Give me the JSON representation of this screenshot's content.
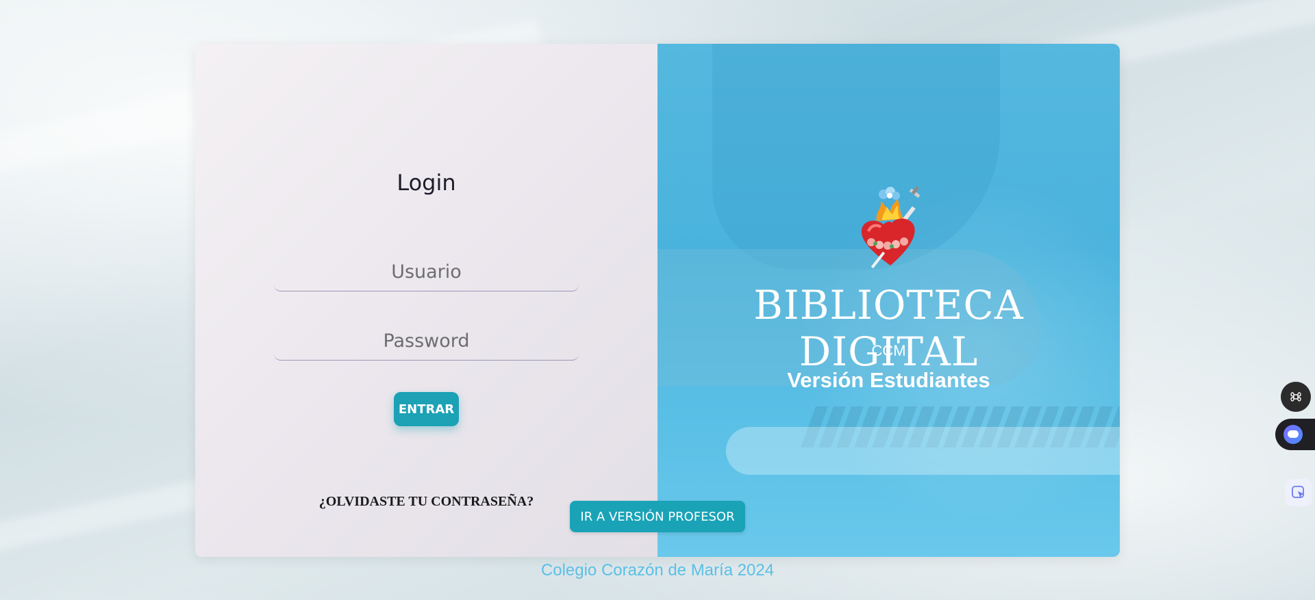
{
  "login": {
    "title": "Login",
    "username_placeholder": "Usuario",
    "password_placeholder": "Password",
    "submit_label": "ENTRAR",
    "forgot_label": "¿OLVIDASTE TU CONTRASEÑA?"
  },
  "hero": {
    "title": "BIBLIOTECA DIGITAL",
    "subtitle": "CCM",
    "version": "Versión Estudiantes",
    "emblem_icon": "sacred-heart-icon"
  },
  "switch_button_label": "IR A VERSIÓN PROFESOR",
  "footer": {
    "text": "Colegio Corazón de María 2024"
  },
  "side_tools": {
    "command_icon": "command-icon",
    "assistant_icon": "assistant-icon",
    "cursor_icon": "cursor-icon"
  },
  "colors": {
    "accent": "#1ca1b5",
    "hero_blue": "#4ab3dd",
    "footer_text": "#5bbfe6"
  }
}
